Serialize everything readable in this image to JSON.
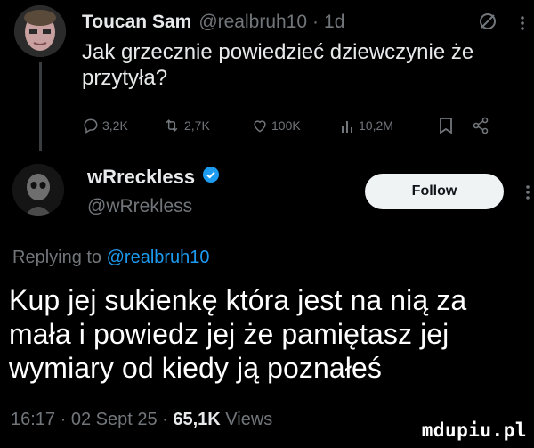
{
  "original_tweet": {
    "author_name": "Toucan Sam",
    "handle": "@realbruh10",
    "separator": "·",
    "time": "1d",
    "text": "Jak grzecznie powiedzieć dziewczynie że przytyła?",
    "metrics": {
      "replies": "3,2K",
      "reposts": "2,7K",
      "likes": "100K",
      "views": "10,2M"
    }
  },
  "reply_tweet": {
    "author_name": "wRreckless",
    "handle": "@wRrekless",
    "follow_label": "Follow",
    "replying_prefix": "Replying to",
    "replying_handle": "@realbruh10",
    "text": "Kup jej sukienkę która jest na nią za mała i powiedz jej że pamiętasz jej wymiary od kiedy ją poznałeś",
    "footer_time": "16:17 · 02 Sept 25 ·",
    "footer_views_count": "65,1K",
    "footer_views_label": "Views"
  },
  "watermark": "mdupiu.pl",
  "colors": {
    "background": "#000000",
    "primary_text": "#e7e9ea",
    "secondary_text": "#71767b",
    "link": "#1d9bf0",
    "verified": "#1d9bf0",
    "follow_button_bg": "#eff3f4"
  },
  "icons": [
    "grok-icon",
    "more-icon",
    "reply-icon",
    "repost-icon",
    "like-icon",
    "views-icon",
    "bookmark-icon",
    "share-icon",
    "verified-badge-icon"
  ]
}
